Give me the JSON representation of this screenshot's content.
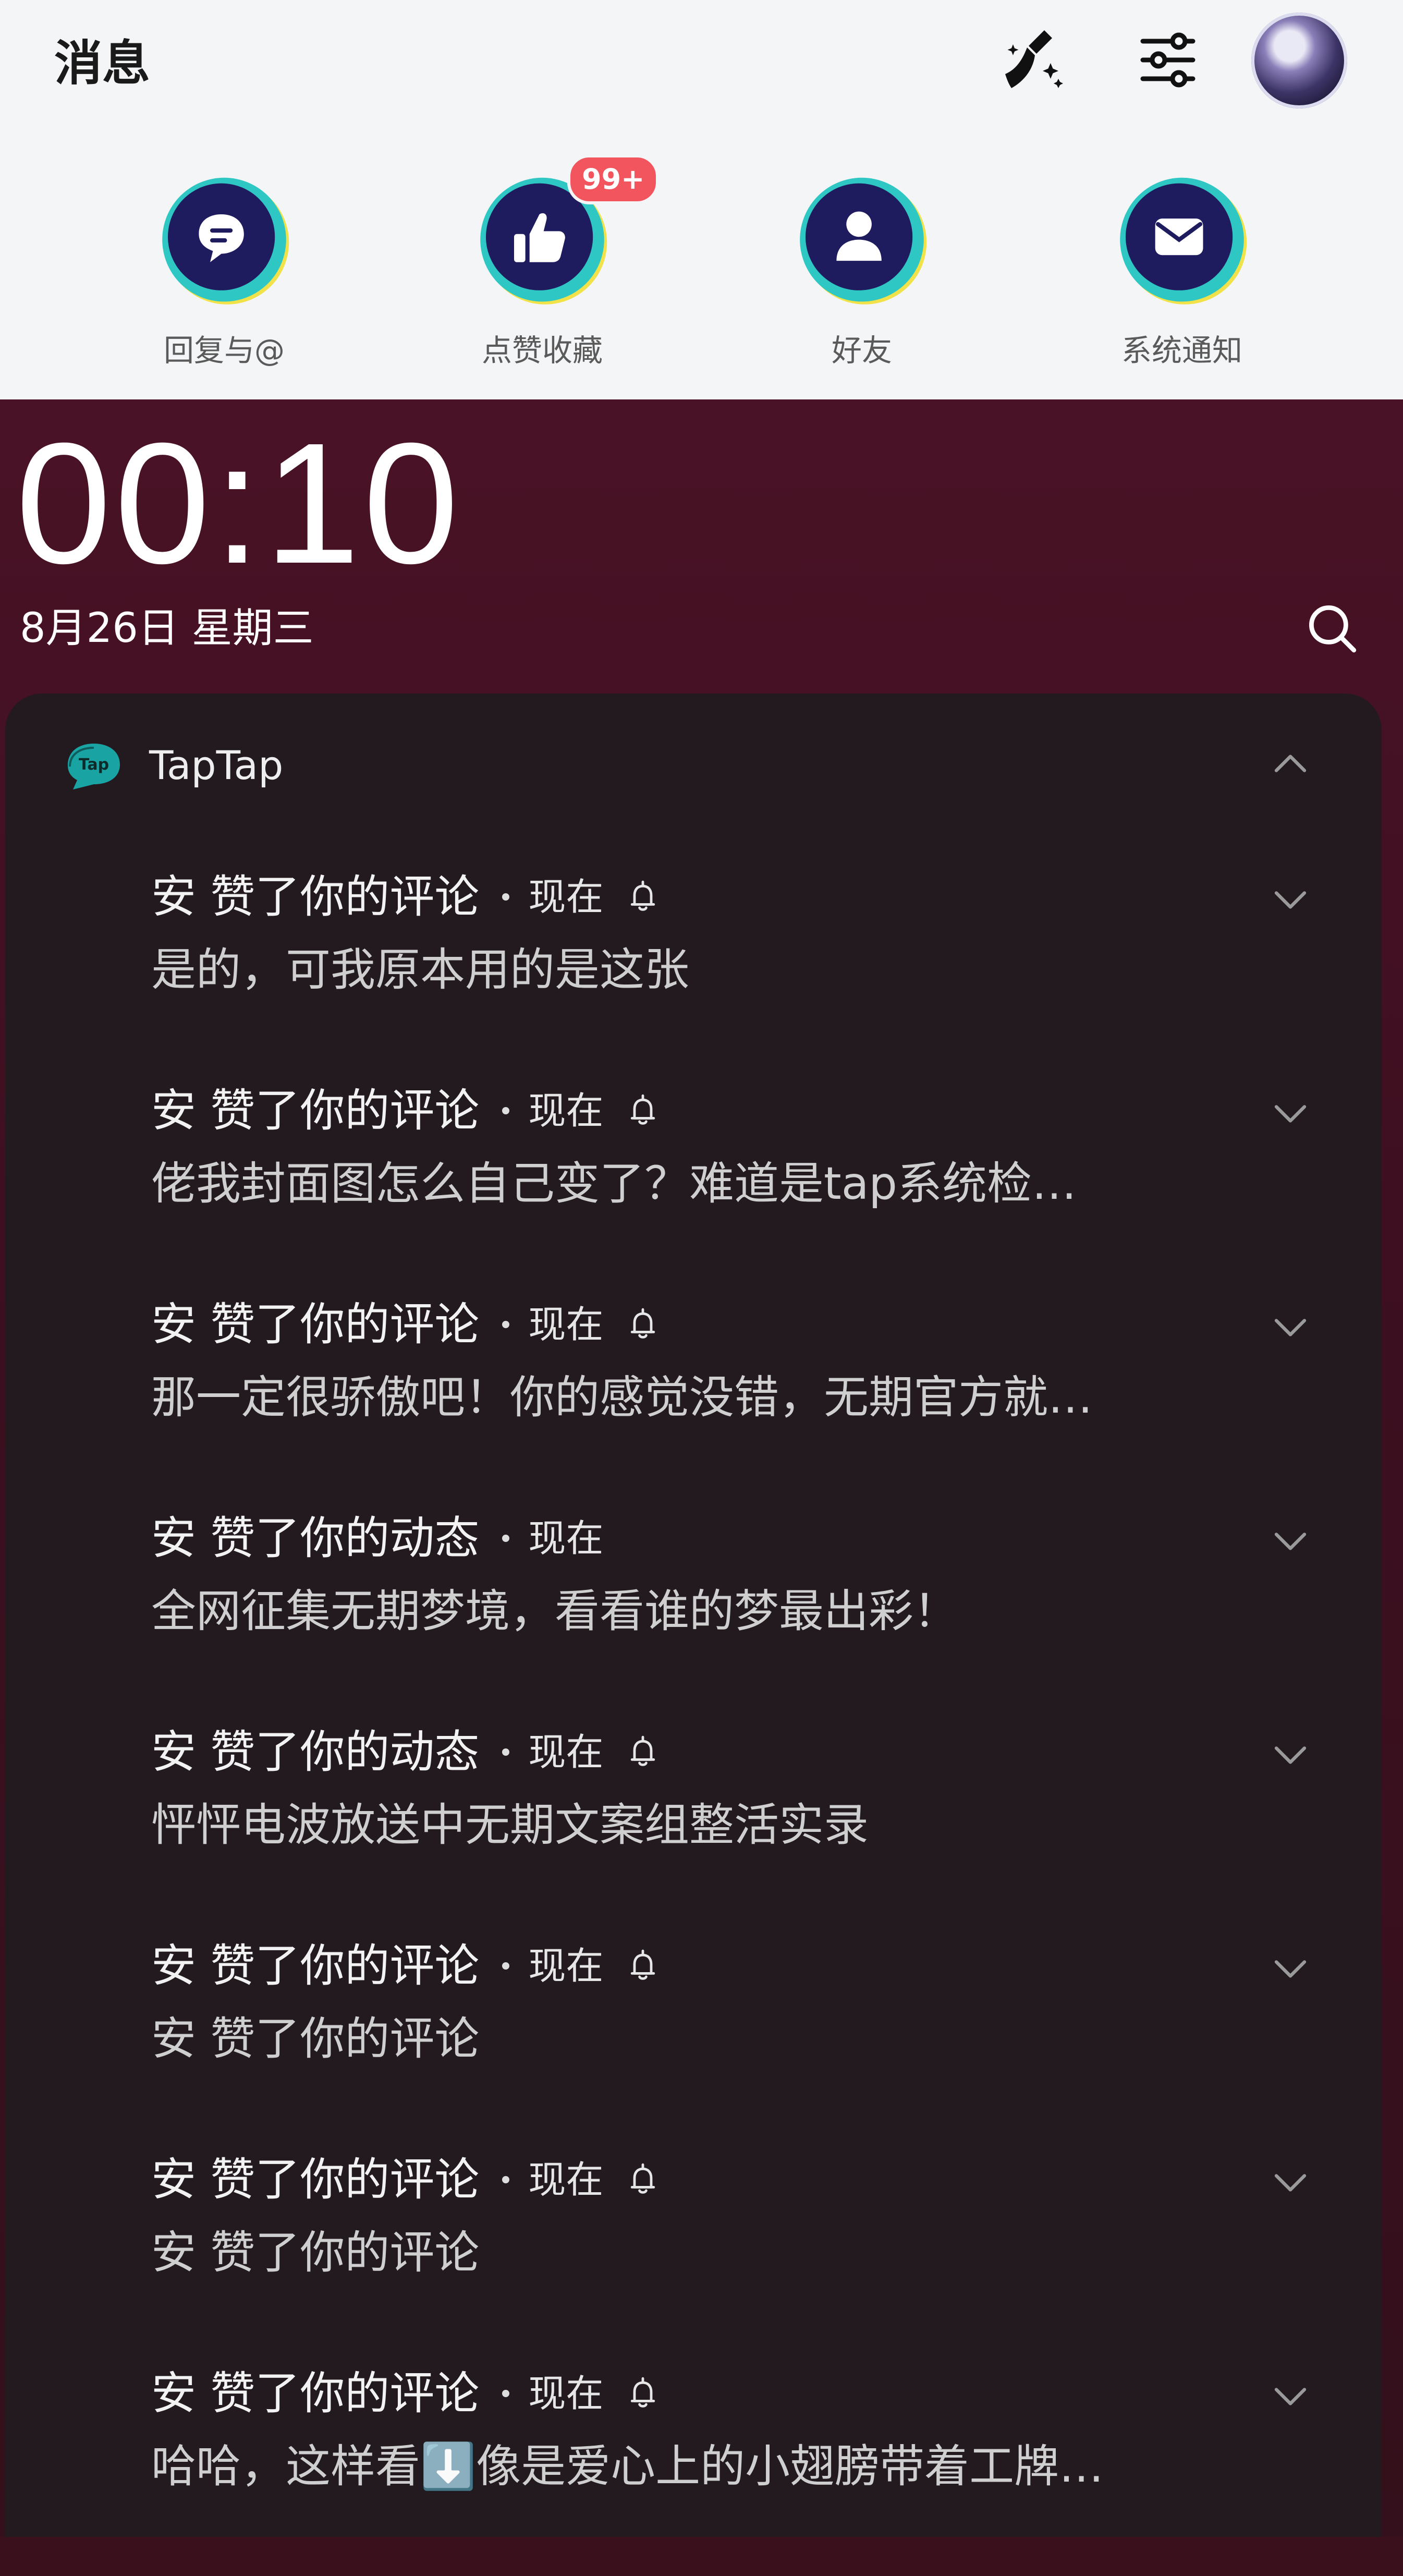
{
  "header": {
    "title": "消息",
    "icons": [
      "broom-icon",
      "filter-settings-icon",
      "avatar"
    ]
  },
  "categories": [
    {
      "label": "回复与@",
      "icon": "chat-bubble-icon"
    },
    {
      "label": "点赞收藏",
      "icon": "thumbs-up-icon",
      "badge": "99+"
    },
    {
      "label": "好友",
      "icon": "person-icon"
    },
    {
      "label": "系统通知",
      "icon": "envelope-icon"
    }
  ],
  "lockscreen": {
    "time": "00:10",
    "date": "8月26日 星期三"
  },
  "notification_group": {
    "app_name": "TapTap",
    "items": [
      {
        "title": "安 赞了你的评论",
        "time": "现在",
        "bell": true,
        "body": "是的，可我原本用的是这张"
      },
      {
        "title": "安 赞了你的评论",
        "time": "现在",
        "bell": true,
        "body": "佬我封面图怎么自己变了？难道是tap系统检…"
      },
      {
        "title": "安 赞了你的评论",
        "time": "现在",
        "bell": true,
        "body": "那一定很骄傲吧！你的感觉没错，无期官方就…"
      },
      {
        "title": "安 赞了你的动态",
        "time": "现在",
        "bell": false,
        "body": "全网征集无期梦境，看看谁的梦最出彩！"
      },
      {
        "title": "安 赞了你的动态",
        "time": "现在",
        "bell": true,
        "body": "怦怦电波放送中无期文案组整活实录"
      },
      {
        "title": "安 赞了你的评论",
        "time": "现在",
        "bell": true,
        "body": "安 赞了你的评论"
      },
      {
        "title": "安 赞了你的评论",
        "time": "现在",
        "bell": true,
        "body": "安 赞了你的评论"
      },
      {
        "title": "安 赞了你的评论",
        "time": "现在",
        "bell": true,
        "body": "哈哈，这样看⬇️像是爱心上的小翅膀带着工牌…"
      }
    ]
  },
  "colors": {
    "ring_cyan": "#2fc7c3",
    "ring_yellow": "#f2e24a",
    "icon_navy": "#1e1b5e",
    "badge_red": "#f2555e",
    "panel_bg": "#221a1f",
    "lock_bg": "#3d0f20"
  }
}
